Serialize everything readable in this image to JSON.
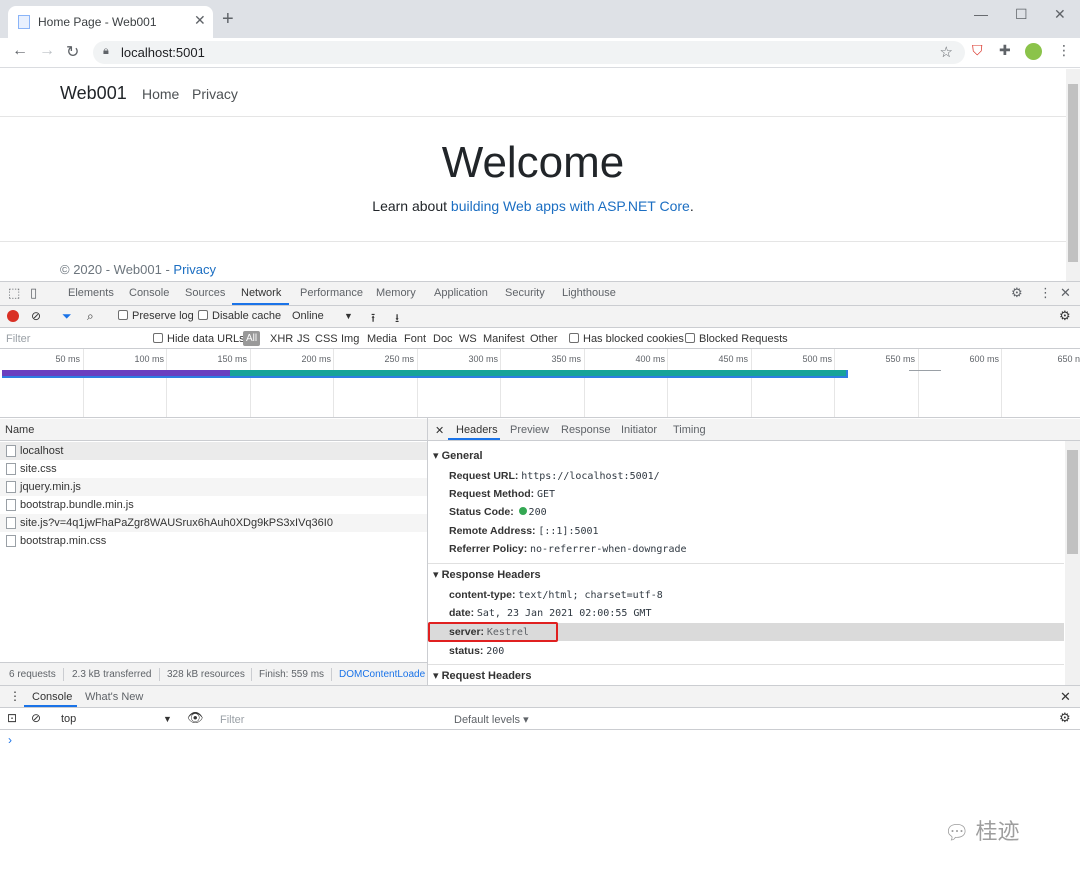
{
  "browser": {
    "tab_title": "Home Page - Web001",
    "url": "localhost:5001"
  },
  "page": {
    "brand": "Web001",
    "nav": [
      "Home",
      "Privacy"
    ],
    "welcome": "Welcome",
    "learn_prefix": "Learn about ",
    "learn_link": "building Web apps with ASP.NET Core",
    "learn_suffix": ".",
    "footer_text": "© 2020 - Web001 - ",
    "footer_link": "Privacy"
  },
  "devtools": {
    "tabs": [
      "Elements",
      "Console",
      "Sources",
      "Network",
      "Performance",
      "Memory",
      "Application",
      "Security",
      "Lighthouse"
    ],
    "active_tab": "Network",
    "toolbar": {
      "preserve_log": "Preserve log",
      "disable_cache": "Disable cache",
      "throttle": "Online"
    },
    "filter": {
      "placeholder": "Filter",
      "hide_data_urls": "Hide data URLs",
      "all": "All",
      "types": [
        "XHR",
        "JS",
        "CSS",
        "Img",
        "Media",
        "Font",
        "Doc",
        "WS",
        "Manifest",
        "Other"
      ],
      "has_blocked_cookies": "Has blocked cookies",
      "blocked_requests": "Blocked Requests"
    },
    "timeline_ticks": [
      "50 ms",
      "100 ms",
      "150 ms",
      "200 ms",
      "250 ms",
      "300 ms",
      "350 ms",
      "400 ms",
      "450 ms",
      "500 ms",
      "550 ms",
      "600 ms",
      "650 n"
    ],
    "name_header": "Name",
    "requests": [
      "localhost",
      "site.css",
      "jquery.min.js",
      "bootstrap.bundle.min.js",
      "site.js?v=4q1jwFhaPaZgr8WAUSrux6hAuh0XDg9kPS3xIVq36I0",
      "bootstrap.min.css"
    ],
    "status": {
      "requests": "6 requests",
      "transferred": "2.3 kB transferred",
      "resources": "328 kB resources",
      "finish": "Finish: 559 ms",
      "dom": "DOMContentLoade"
    },
    "detail_tabs": [
      "Headers",
      "Preview",
      "Response",
      "Initiator",
      "Timing"
    ],
    "general_title": "General",
    "general": [
      {
        "k": "Request URL:",
        "v": "https://localhost:5001/"
      },
      {
        "k": "Request Method:",
        "v": "GET"
      },
      {
        "k": "Status Code:",
        "v": "200"
      },
      {
        "k": "Remote Address:",
        "v": "[::1]:5001"
      },
      {
        "k": "Referrer Policy:",
        "v": "no-referrer-when-downgrade"
      }
    ],
    "response_title": "Response Headers",
    "response": [
      {
        "k": "content-type:",
        "v": "text/html; charset=utf-8"
      },
      {
        "k": "date:",
        "v": "Sat, 23 Jan 2021 02:00:55 GMT"
      },
      {
        "k": "server:",
        "v": "Kestrel"
      },
      {
        "k": "status:",
        "v": "200"
      }
    ],
    "request_title": "Request Headers",
    "drawer_tabs": [
      "Console",
      "What's New"
    ],
    "console": {
      "context": "top",
      "filter_placeholder": "Filter",
      "levels": "Default levels ▾",
      "prompt": "›"
    }
  },
  "watermark": "桂迹"
}
